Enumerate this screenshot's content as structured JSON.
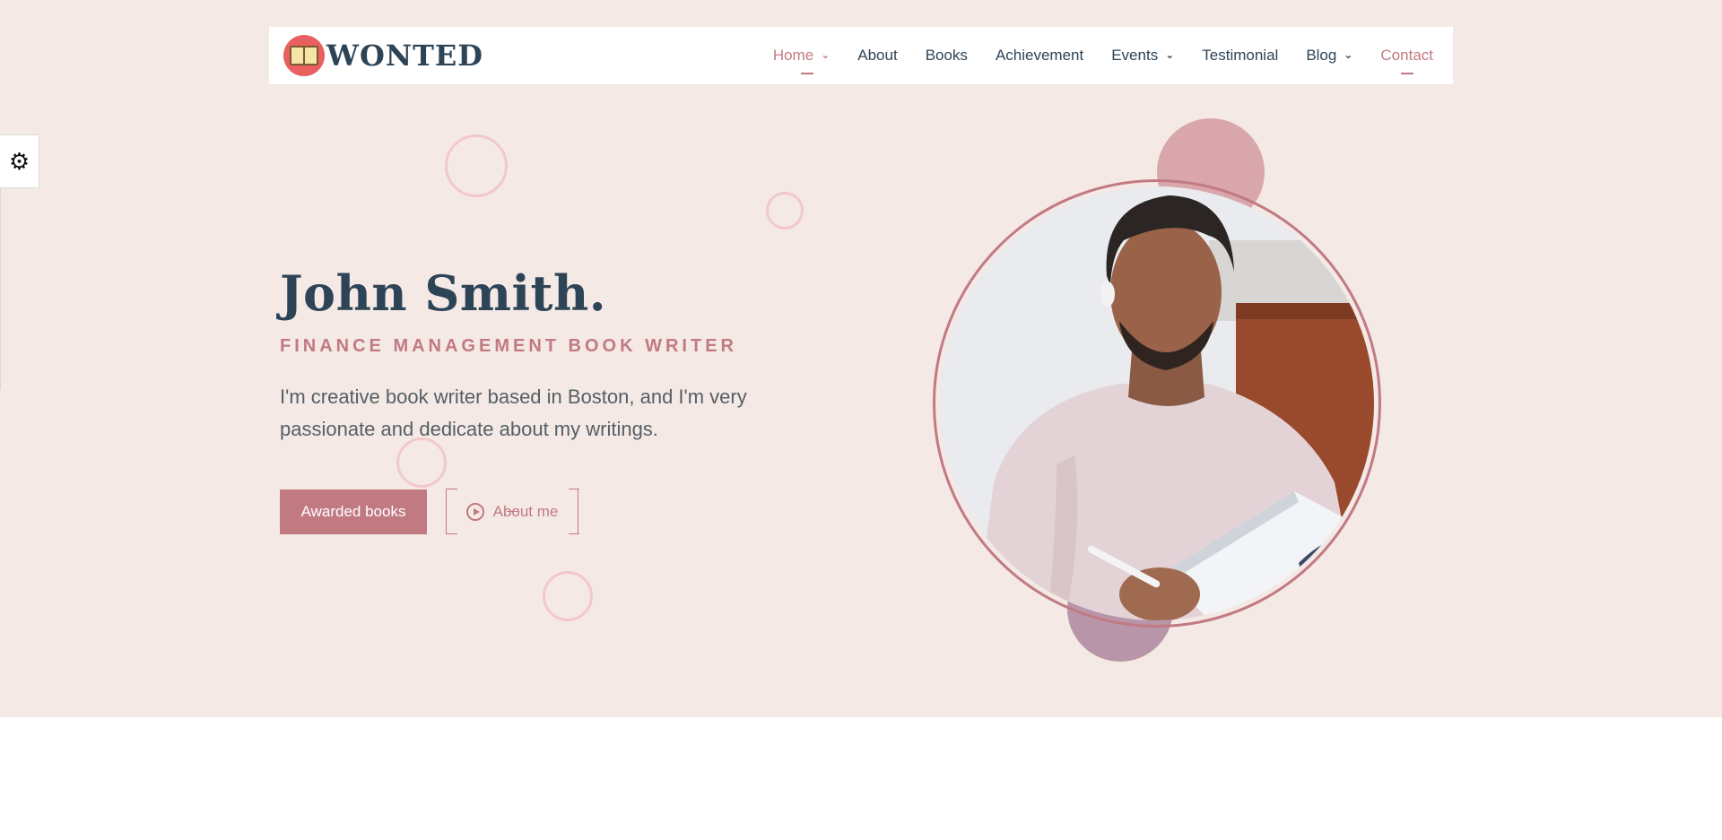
{
  "brand": {
    "name": "WONTED",
    "logo_icon": "open-book-icon",
    "accent": "#c27a82",
    "navy": "#2d4457",
    "hero_bg": "#f4e9e5"
  },
  "nav": {
    "items": [
      {
        "label": "Home",
        "has_dropdown": true,
        "active": true
      },
      {
        "label": "About",
        "has_dropdown": false
      },
      {
        "label": "Books",
        "has_dropdown": false
      },
      {
        "label": "Achievement",
        "has_dropdown": false
      },
      {
        "label": "Events",
        "has_dropdown": true
      },
      {
        "label": "Testimonial",
        "has_dropdown": false
      },
      {
        "label": "Blog",
        "has_dropdown": true
      },
      {
        "label": "Contact",
        "has_dropdown": false,
        "highlight": true
      }
    ]
  },
  "settings": {
    "icon": "gear-icon"
  },
  "hero": {
    "name": "John Smith.",
    "subtitle": "FINANCE MANAGEMENT BOOK WRITER",
    "description": "I'm creative book writer based in Boston, and I'm very passionate and dedicate about my writings.",
    "primary_button": "Awarded books",
    "secondary_button": "About me",
    "secondary_icon": "play-circle-icon"
  }
}
